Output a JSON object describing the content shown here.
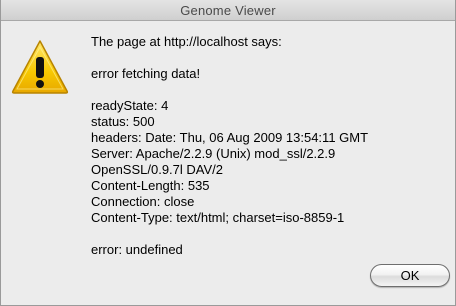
{
  "window": {
    "title": "Genome Viewer"
  },
  "dialog": {
    "icon": "warning-triangle-icon",
    "heading": "The page at http://localhost says:",
    "message": "error fetching data!",
    "details": [
      "readyState: 4",
      "status: 500",
      "headers: Date: Thu, 06 Aug 2009 13:54:11 GMT",
      "Server: Apache/2.2.9 (Unix) mod_ssl/2.2.9",
      "OpenSSL/0.9.7l DAV/2",
      "Content-Length: 535",
      "Connection: close",
      "Content-Type: text/html; charset=iso-8859-1"
    ],
    "error_line": "error: undefined",
    "ok_label": "OK"
  }
}
